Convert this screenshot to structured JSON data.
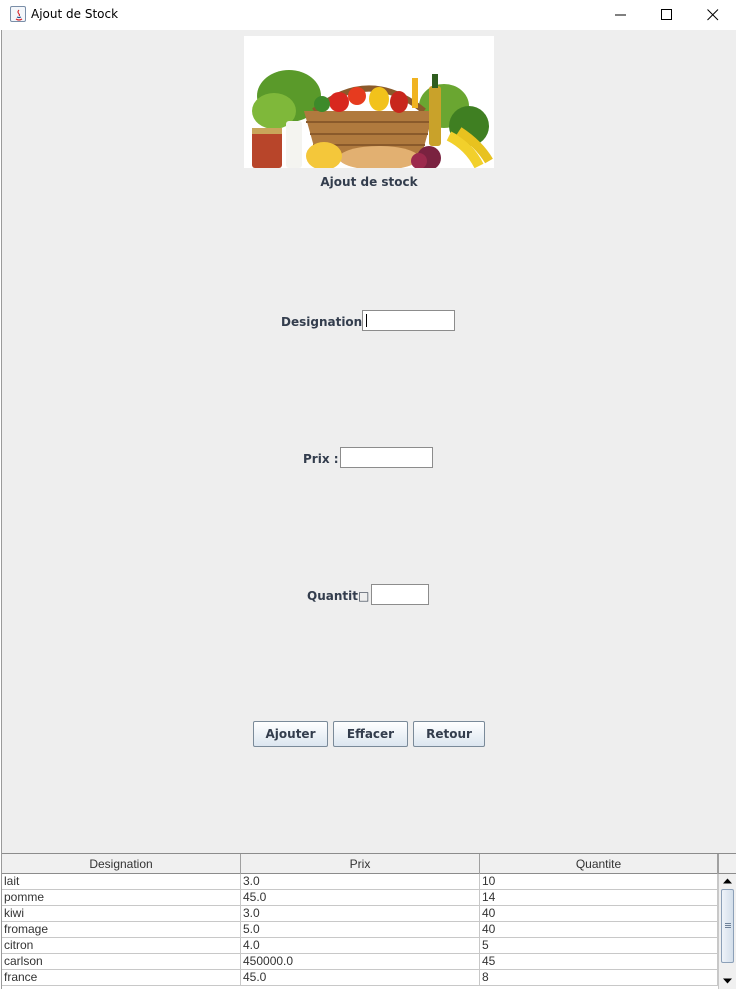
{
  "window": {
    "title": "Ajout de Stock"
  },
  "form": {
    "heading": "Ajout de stock",
    "designation": {
      "label": "Designation :",
      "value": ""
    },
    "prix": {
      "label": "Prix :",
      "value": ""
    },
    "quantite": {
      "label": "Quantit□ :",
      "value": ""
    }
  },
  "buttons": {
    "add": "Ajouter",
    "clear": "Effacer",
    "back": "Retour"
  },
  "table": {
    "columns": [
      "Designation",
      "Prix",
      "Quantite"
    ],
    "rows": [
      [
        "lait",
        "3.0",
        "10"
      ],
      [
        "pomme",
        "45.0",
        "14"
      ],
      [
        "kiwi",
        "3.0",
        "40"
      ],
      [
        "fromage",
        "5.0",
        "40"
      ],
      [
        "citron",
        "4.0",
        "5"
      ],
      [
        "carlson",
        "450000.0",
        "45"
      ],
      [
        "france",
        "45.0",
        "8"
      ]
    ]
  },
  "colors": {
    "panel_bg": "#eeeeee",
    "label_text": "#333d4d",
    "button_gradient_end": "#dce6f0"
  },
  "icons": [
    "java-icon",
    "minimize-icon",
    "maximize-icon",
    "close-icon",
    "scroll-up-arrow-icon",
    "scroll-down-arrow-icon",
    "food-basket-image"
  ]
}
